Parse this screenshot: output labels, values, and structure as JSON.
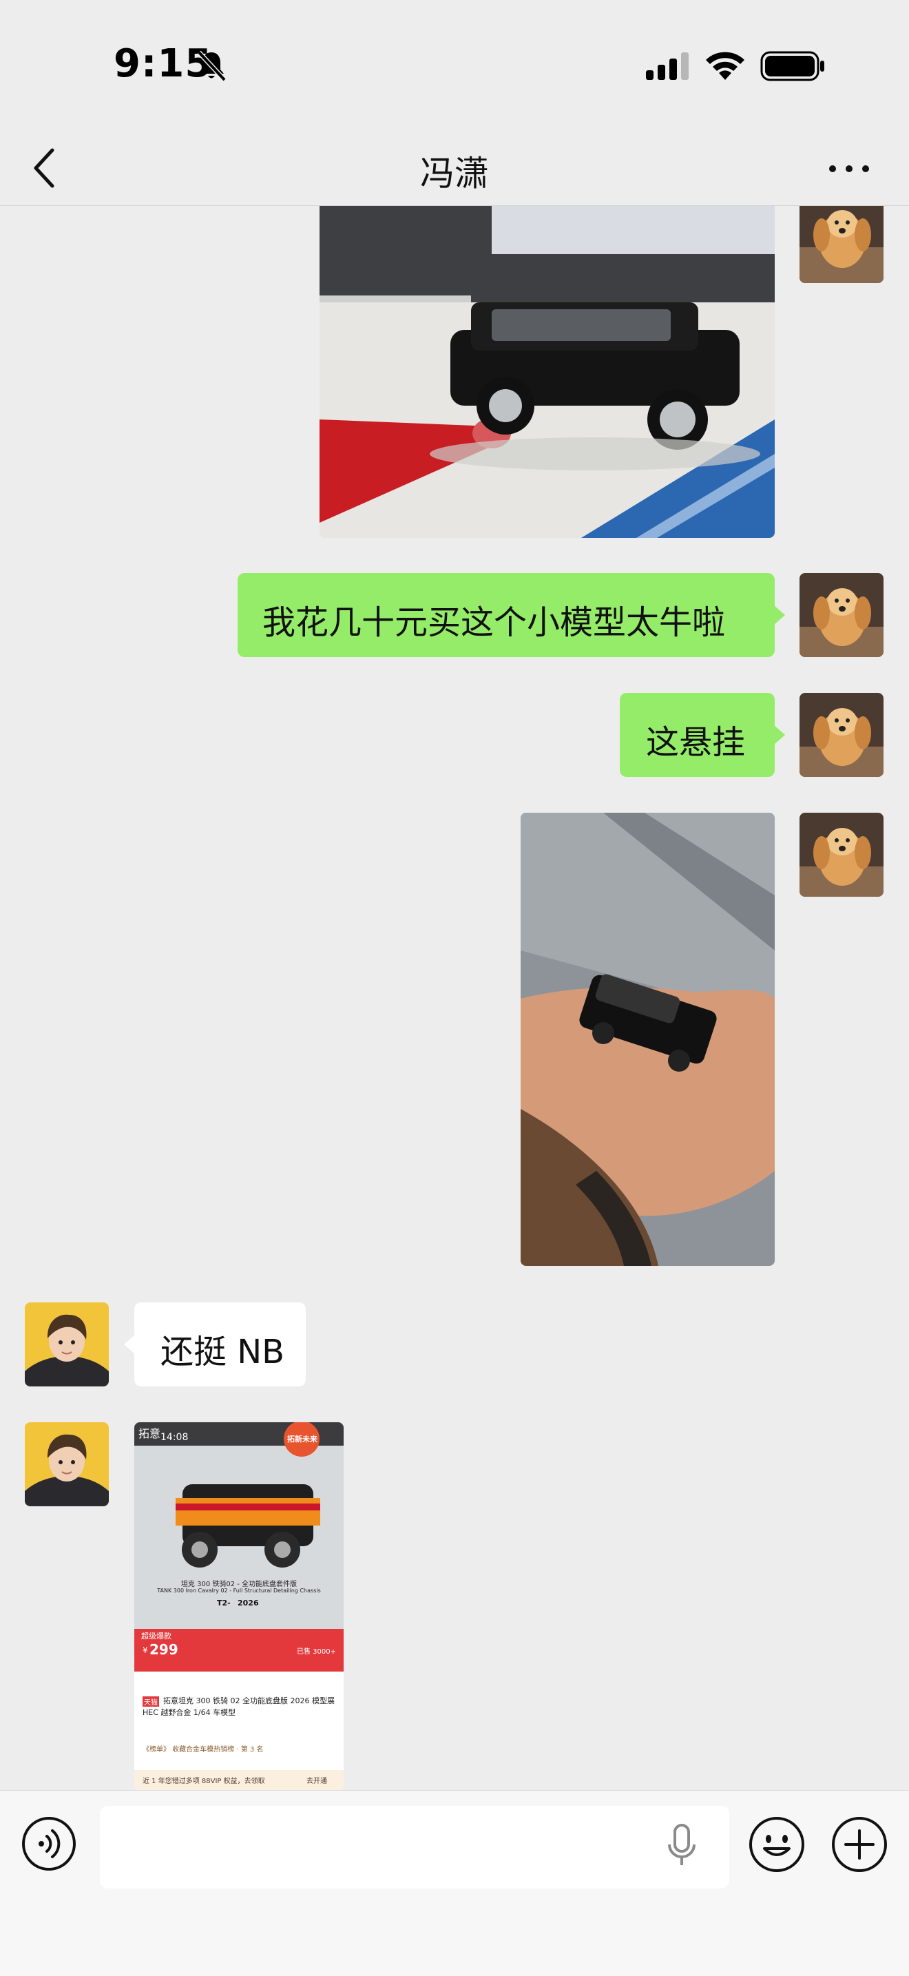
{
  "status_bar": {
    "time": "9:15"
  },
  "chat": {
    "title": "冯潇",
    "messages": [
      {
        "sender": "self",
        "type": "image",
        "content": "black toy SUV model on desk"
      },
      {
        "sender": "self",
        "type": "text",
        "text": "我花几十元买这个小模型太牛啦"
      },
      {
        "sender": "self",
        "type": "text",
        "text": "这悬挂"
      },
      {
        "sender": "self",
        "type": "image",
        "content": "toy SUV in hand"
      },
      {
        "sender": "other",
        "type": "text",
        "text": "还挺 NB"
      },
      {
        "sender": "other",
        "type": "image",
        "content": "product listing screenshot"
      }
    ]
  },
  "listing": {
    "shop": "拓意",
    "time": "14:08",
    "model_name_cn": "坦克 300 铁骑02 - 全功能底盘套件版",
    "model_name_en": "TANK 300 Iron Cavalry 02 - Full Structural Detailing Chassis",
    "model_code": "T2-",
    "model_year": "2026",
    "promo": "超级爆款",
    "currency": "¥",
    "price": "299",
    "sold": "已售 3000+",
    "product_tag": "天猫",
    "product_title": "拓意坦克 300 铁骑 02 全功能底盘版 2026 模型展 HEC 越野合金 1/64 车模型",
    "rank_text": "《榜单》 收藏合金车模热销榜 · 第 3 名",
    "vip_text": "近 1 年您错过多项 88VIP 权益，去领取",
    "vip_action": "去开通",
    "brand_badge": "拓新未来"
  },
  "colors": {
    "self_bubble": "#95ec69",
    "other_bubble": "#ffffff",
    "background": "#ededed",
    "price_red": "#e4393c"
  },
  "icons": [
    "back-icon",
    "more-icon",
    "voice-icon",
    "microphone-icon",
    "emoji-icon",
    "plus-icon",
    "bell-off-icon",
    "signal-icon",
    "wifi-icon",
    "battery-icon"
  ]
}
